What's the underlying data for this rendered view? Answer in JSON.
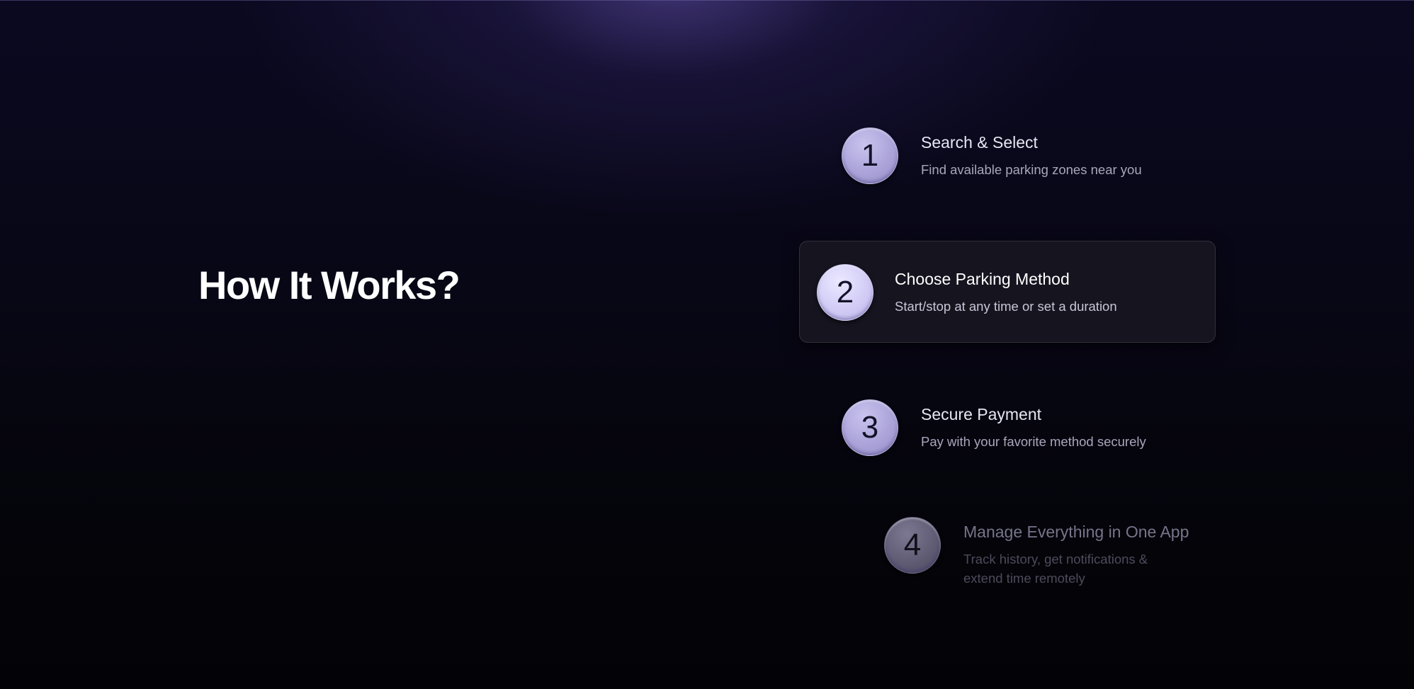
{
  "heading": "How It Works?",
  "steps": [
    {
      "number": "1",
      "title": "Search & Select",
      "description": "Find available parking zones near you"
    },
    {
      "number": "2",
      "title": "Choose Parking Method",
      "description": "Start/stop at any time or set a duration"
    },
    {
      "number": "3",
      "title": "Secure Payment",
      "description": "Pay with your favorite method securely"
    },
    {
      "number": "4",
      "title": "Manage Everything in One App",
      "description": "Track history, get notifications & extend time remotely"
    }
  ],
  "active_step": "2",
  "colors": {
    "background": "#05040d",
    "glow": "#6e5abe",
    "step_circle": "#aba3d9",
    "active_card": "#15141f"
  }
}
